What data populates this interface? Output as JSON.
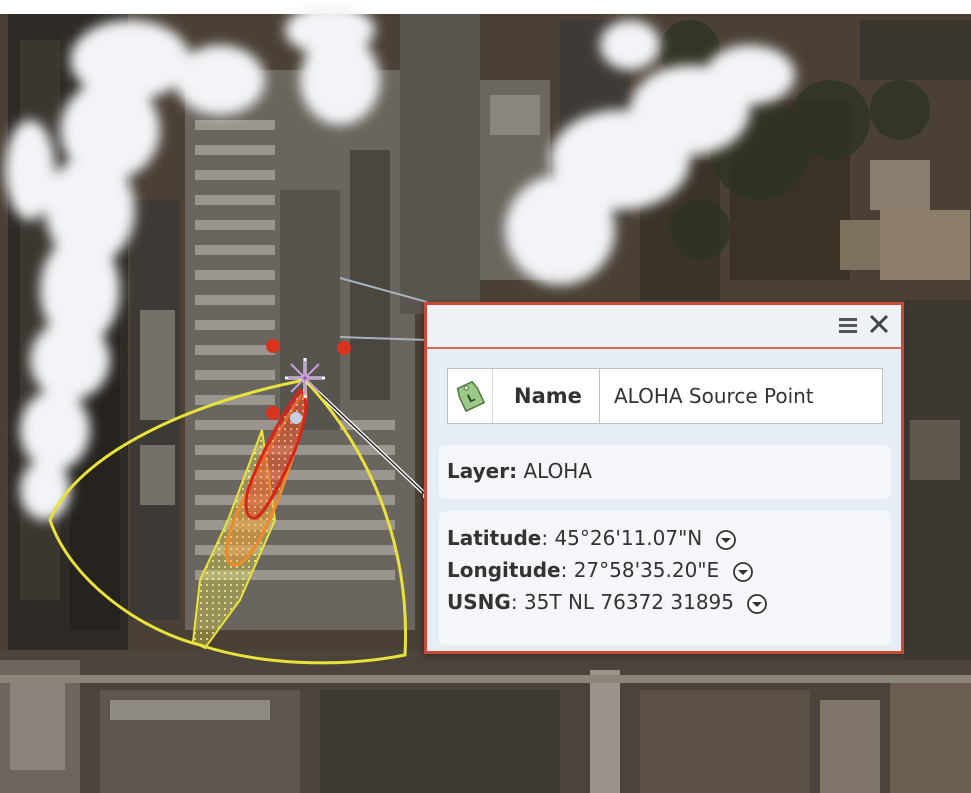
{
  "popup": {
    "name_label": "Name",
    "name_value": "ALOHA Source Point",
    "name_icon": "map-tag-icon",
    "layer_label": "Layer:",
    "layer_value": "ALOHA",
    "latitude_label": "Latitude",
    "latitude_value": "45°26'11.07\"N",
    "longitude_label": "Longitude",
    "longitude_value": "27°58'35.20\"E",
    "usng_label": "USNG",
    "usng_value": "35T NL 76372 31895",
    "icons": [
      "menu-icon",
      "close-icon",
      "expand-chevron-icon"
    ]
  },
  "colors": {
    "popup_border": "#c94a36",
    "threat_zone_yellow": "#e8e23a",
    "threat_zone_orange": "#ee8a2c",
    "threat_zone_red": "#d8251c",
    "source_point": "#d8331f"
  }
}
